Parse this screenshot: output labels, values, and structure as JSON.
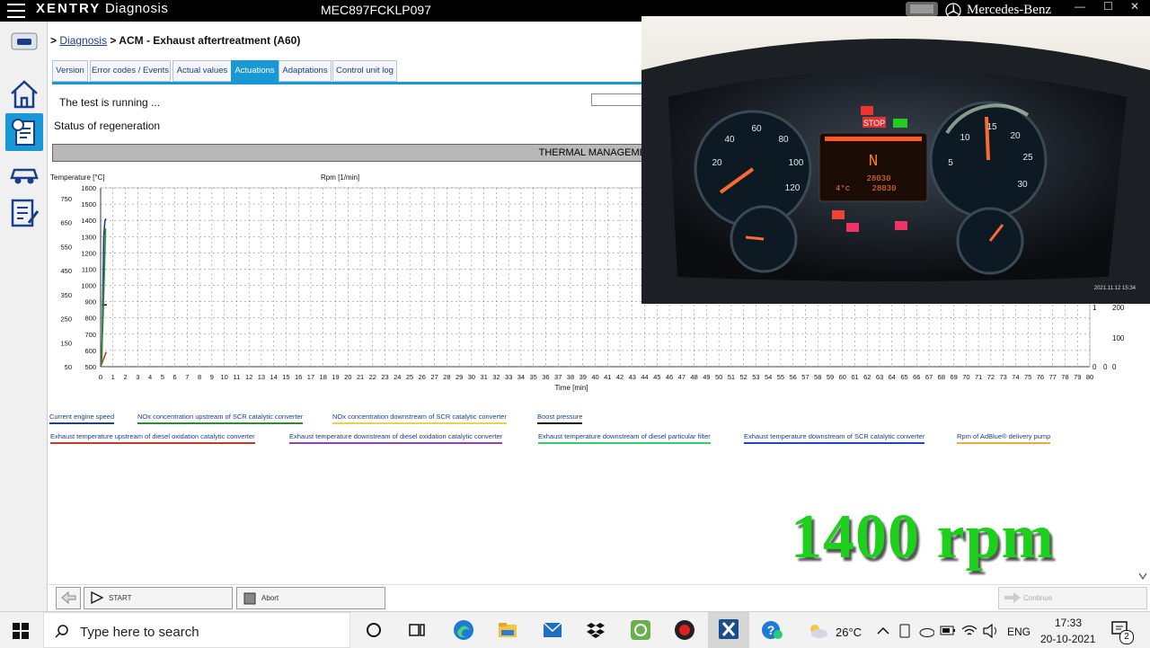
{
  "titlebar": {
    "brand_bold": "XENTRY",
    "brand_rest": " Diagnosis",
    "vin": "MEC897FCKLP097",
    "mercedes": "Mercedes-Benz",
    "min_glyph": "—",
    "max_glyph": "☐",
    "close_glyph": "✕"
  },
  "breadcrumb": {
    "prefix": ">",
    "link": "Diagnosis",
    "current": "> ACM - Exhaust aftertreatment (A60)"
  },
  "tabs": [
    {
      "label": "Version"
    },
    {
      "label": "Error codes / Events"
    },
    {
      "label": "Actual values"
    },
    {
      "label": "Actuations"
    },
    {
      "label": "Adaptations"
    },
    {
      "label": "Control unit log"
    }
  ],
  "main": {
    "running_text": "The test is running ...",
    "status_text": "Status of regeneration",
    "thermal_label": "THERMAL MANAGEME"
  },
  "chart_data": {
    "type": "line",
    "ylabel_left": "Temperature [°C]",
    "ylabel_mid": "Rpm [1/min]",
    "xlabel": "Time [min]",
    "temp_ticks": [
      750,
      650,
      550,
      450,
      350,
      250,
      150,
      50
    ],
    "rpm_ticks": [
      1600,
      1500,
      1400,
      1300,
      1200,
      1100,
      1000,
      900,
      800,
      700,
      600,
      500
    ],
    "right_ticks_a": [
      1,
      0
    ],
    "right_ticks_b": [
      200,
      100,
      0
    ],
    "right_ticks_c": [
      0
    ],
    "xlim": [
      0,
      80
    ],
    "ylim_rpm": [
      500,
      1600
    ],
    "series": [
      {
        "name": "Current engine speed",
        "color": "#1f3f8f",
        "x": [
          0.0,
          0.1,
          0.25,
          0.35,
          0.45
        ],
        "y": [
          500,
          560,
          1300,
          1400,
          1410
        ]
      },
      {
        "name": "Exhaust temperature upstream of diesel oxidation catalytic converter",
        "color": "#c0392b",
        "x": [
          0.0,
          0.2,
          0.45
        ],
        "y": [
          500,
          540,
          590
        ]
      },
      {
        "name": "Boost pressure",
        "color": "#000000",
        "x": [
          0.1,
          0.3,
          0.5
        ],
        "y": [
          880,
          880,
          880
        ]
      },
      {
        "name": "NOx concentration upstream of SCR catalytic converter",
        "color": "#2e8b2e",
        "x": [
          0.05,
          0.2,
          0.4
        ],
        "y": [
          510,
          800,
          1350
        ]
      }
    ]
  },
  "legend": {
    "row1": [
      {
        "label": "Current engine speed",
        "color": "#1f3f8f"
      },
      {
        "label": "NOx concentration upstream of SCR catalytic converter",
        "color": "#2e8b2e"
      },
      {
        "label": "NOx concentration downstream of SCR catalytic converter",
        "color": "#e8d44a"
      },
      {
        "label": "Boost pressure",
        "color": "#111111"
      }
    ],
    "row2": [
      {
        "label": "Exhaust temperature upstream of diesel oxidation catalytic converter",
        "color": "#c0392b"
      },
      {
        "label": "Exhaust temperature downstream of diesel oxidation catalytic converter",
        "color": "#8e44ad"
      },
      {
        "label": "Exhaust temperature downstream of diesel particular filter",
        "color": "#2ecc71"
      },
      {
        "label": "Exhaust temperature downstream of SCR catalytic converter",
        "color": "#1f47c0"
      },
      {
        "label": "Rpm of AdBlue® delivery pump",
        "color": "#f0a830"
      }
    ]
  },
  "overlay": {
    "rpm_text": "1400 rpm",
    "timestamp": "2021.11.12 15:34",
    "gear": "N",
    "odometer_top": "28030",
    "odometer_bottom": "28030",
    "temp_reading": "4°c",
    "speedo_numbers": [
      "20",
      "40",
      "60",
      "80",
      "100",
      "120"
    ],
    "tacho_numbers": [
      "5",
      "10",
      "15",
      "20",
      "25",
      "30"
    ],
    "stop_label": "STOP"
  },
  "bottombar": {
    "start_label": "START",
    "abort_label": "Abort",
    "continue_label": "Continue"
  },
  "taskbar": {
    "search_placeholder": "Type here to search",
    "weather": "26°C",
    "language": "ENG",
    "time": "17:33",
    "date": "20-10-2021",
    "notifications": "2"
  }
}
